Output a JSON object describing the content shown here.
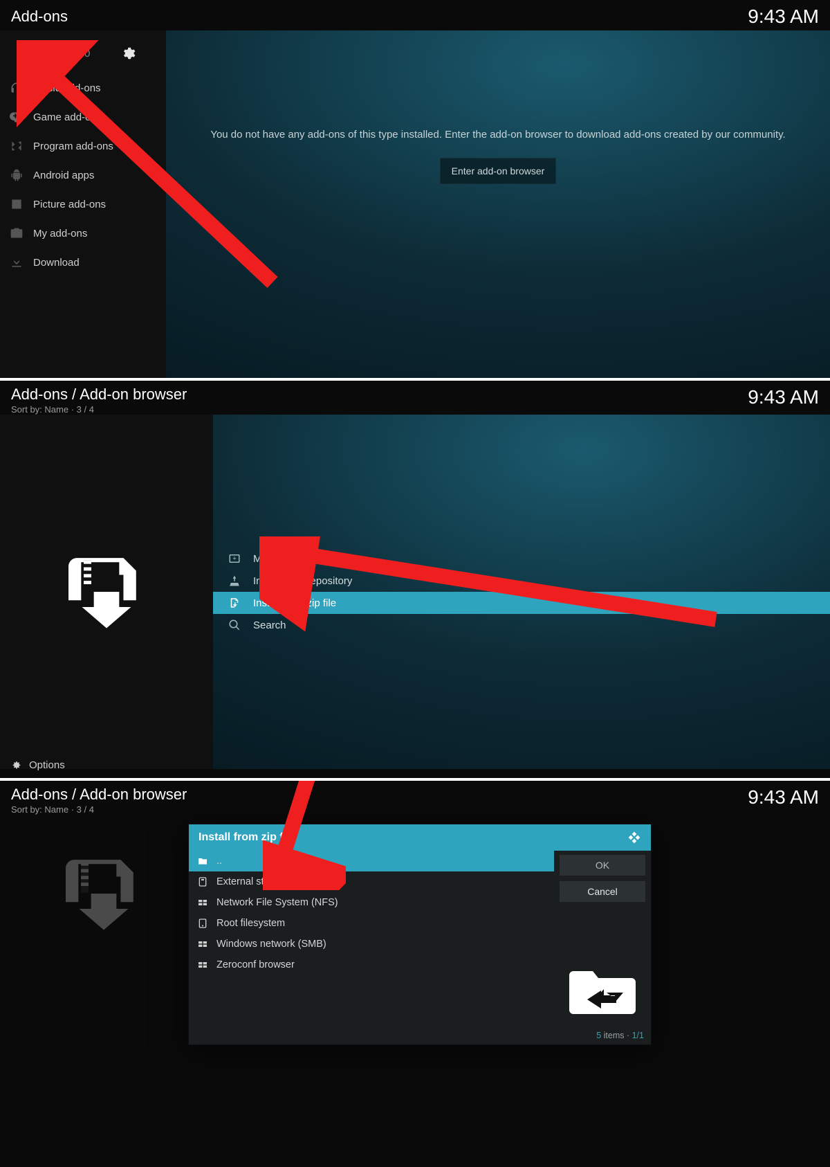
{
  "screen1": {
    "title": "Add-ons",
    "time": "9:43 AM",
    "updates_count": "0",
    "sidebar": [
      {
        "label": "Music add-ons"
      },
      {
        "label": "Game add-ons"
      },
      {
        "label": "Program add-ons"
      },
      {
        "label": "Android apps"
      },
      {
        "label": "Picture add-ons"
      },
      {
        "label": "My add-ons"
      },
      {
        "label": "Download"
      }
    ],
    "empty_text": "You do not have any add-ons of this type installed. Enter the add-on browser to download add-ons created by our community.",
    "browser_button": "Enter add-on browser"
  },
  "screen2": {
    "title": "Add-ons / Add-on browser",
    "subtitle": "Sort by: Name  ·  3 / 4",
    "time": "9:43 AM",
    "items": [
      {
        "label": "My add-ons"
      },
      {
        "label": "Install from repository"
      },
      {
        "label": "Install from zip file"
      },
      {
        "label": "Search"
      }
    ],
    "options_label": "Options"
  },
  "screen3": {
    "title": "Add-ons / Add-on browser",
    "subtitle": "Sort by: Name  ·  3 / 4",
    "time": "9:43 AM",
    "dialog": {
      "title": "Install from zip file",
      "rows": [
        {
          "label": ".."
        },
        {
          "label": "External storage"
        },
        {
          "label": "Network File System (NFS)"
        },
        {
          "label": "Root filesystem"
        },
        {
          "label": "Windows network (SMB)"
        },
        {
          "label": "Zeroconf browser"
        }
      ],
      "ok": "OK",
      "cancel": "Cancel",
      "status_count": "5",
      "status_items": " items · ",
      "status_pos": "1/1"
    }
  }
}
